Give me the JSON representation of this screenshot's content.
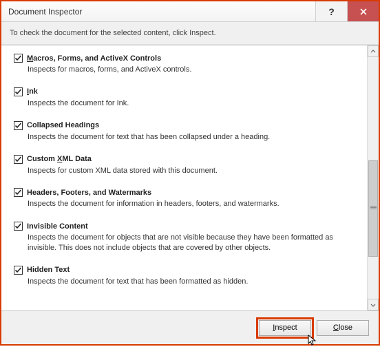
{
  "window": {
    "title": "Document Inspector",
    "help_label": "?",
    "close_label": "X"
  },
  "subtitle": "To check the document for the selected content, click Inspect.",
  "items": [
    {
      "checked": true,
      "title_pre": "",
      "mn": "M",
      "title_post": "acros, Forms, and ActiveX Controls",
      "desc": "Inspects for macros, forms, and ActiveX controls."
    },
    {
      "checked": true,
      "title_pre": "",
      "mn": "I",
      "title_post": "nk",
      "desc": "Inspects the document for Ink."
    },
    {
      "checked": true,
      "title_pre": "Collapsed Headings",
      "mn": "",
      "title_post": "",
      "desc": "Inspects the document for text that has been collapsed under a heading."
    },
    {
      "checked": true,
      "title_pre": "Custom ",
      "mn": "X",
      "title_post": "ML Data",
      "desc": "Inspects for custom XML data stored with this document."
    },
    {
      "checked": true,
      "title_pre": "Headers, Footers, and Watermarks",
      "mn": "",
      "title_post": "",
      "desc": "Inspects the document for information in headers, footers, and watermarks."
    },
    {
      "checked": true,
      "title_pre": "Invisible Content",
      "mn": "",
      "title_post": "",
      "desc": "Inspects the document for objects that are not visible because they have been formatted as invisible. This does not include objects that are covered by other objects."
    },
    {
      "checked": true,
      "title_pre": "Hidden Text",
      "mn": "",
      "title_post": "",
      "desc": "Inspects the document for text that has been formatted as hidden."
    }
  ],
  "footer": {
    "inspect_mn": "I",
    "inspect_post": "nspect",
    "close_mn": "C",
    "close_post": "lose"
  }
}
